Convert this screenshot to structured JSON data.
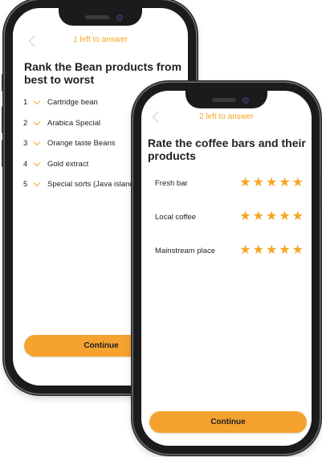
{
  "colors": {
    "accent": "#f5a623",
    "button": "#f5a22e",
    "text": "#1f1f24"
  },
  "screen1": {
    "progress": "1 left to answer",
    "title": "Rank the Bean products from best to worst",
    "items": [
      {
        "rank": "1",
        "label": "Cartridge bean"
      },
      {
        "rank": "2",
        "label": "Arabica Special"
      },
      {
        "rank": "3",
        "label": "Orange taste Beans"
      },
      {
        "rank": "4",
        "label": "Gold extract"
      },
      {
        "rank": "5",
        "label": "Special sorts (Java island)"
      }
    ],
    "button": "Continue"
  },
  "screen2": {
    "progress": "2 left to answer",
    "title": "Rate the coffee bars and their products",
    "items": [
      {
        "label": "Fresh bar",
        "rating": 5
      },
      {
        "label": "Local coffee",
        "rating": 5
      },
      {
        "label": "Mainstream place",
        "rating": 5
      }
    ],
    "button": "Continue",
    "max_rating": 5
  },
  "icons": {
    "back": "chevron-left-icon",
    "rank": "chevron-down-icon",
    "rating": "star-icon"
  }
}
